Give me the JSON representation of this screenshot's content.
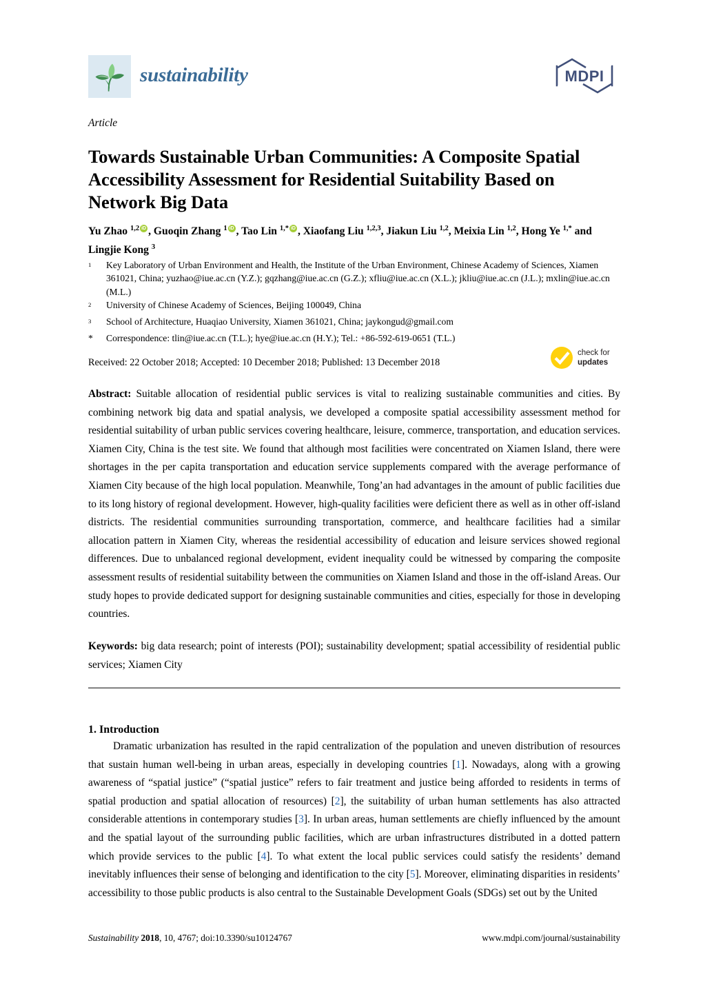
{
  "header": {
    "journal_name": "sustainability",
    "publisher_logo_text": "MDPI",
    "logo_icon": "seedling-leaf-icon"
  },
  "article_type": "Article",
  "title": "Towards Sustainable Urban Communities: A Composite Spatial Accessibility Assessment for Residential Suitability Based on Network Big Data",
  "authors_line_1_html": "Yu Zhao <sup>1,2</sup>ORCID, Guoqin Zhang <sup>1</sup>ORCID, Tao Lin <sup>1,*</sup>ORCID, Xiaofang Liu <sup>1,2,3</sup>, Jiakun Liu <sup>1,2</sup>, Meixia Lin <sup>1,2</sup>,",
  "authors_line_2_html": "Hong Ye <sup>1,*</sup> and Lingjie Kong <sup>3</sup>",
  "authors": [
    {
      "name": "Yu Zhao",
      "sup": "1,2",
      "orcid": true
    },
    {
      "name": "Guoqin Zhang",
      "sup": "1",
      "orcid": true
    },
    {
      "name": "Tao Lin",
      "sup": "1,*",
      "orcid": true
    },
    {
      "name": "Xiaofang Liu",
      "sup": "1,2,3",
      "orcid": false
    },
    {
      "name": "Jiakun Liu",
      "sup": "1,2",
      "orcid": false
    },
    {
      "name": "Meixia Lin",
      "sup": "1,2",
      "orcid": false
    },
    {
      "name": "Hong Ye",
      "sup": "1,*",
      "orcid": false
    },
    {
      "name": "Lingjie Kong",
      "sup": "3",
      "orcid": false
    }
  ],
  "affiliations": [
    {
      "marker": "1",
      "text": "Key Laboratory of Urban Environment and Health, the Institute of the Urban Environment, Chinese Academy of Sciences, Xiamen 361021, China; yuzhao@iue.ac.cn (Y.Z.); gqzhang@iue.ac.cn (G.Z.); xfliu@iue.ac.cn (X.L.); jkliu@iue.ac.cn (J.L.); mxlin@iue.ac.cn (M.L.)"
    },
    {
      "marker": "2",
      "text": "University of Chinese Academy of Sciences, Beijing 100049, China"
    },
    {
      "marker": "3",
      "text": "School of Architecture, Huaqiao University, Xiamen 361021, China; jaykongud@gmail.com"
    },
    {
      "marker": "*",
      "text": "Correspondence: tlin@iue.ac.cn (T.L.); hye@iue.ac.cn (H.Y.); Tel.: +86-592-619-0651 (T.L.)"
    }
  ],
  "dates_line": "Received: 22 October 2018; Accepted: 10 December 2018; Published: 13 December 2018",
  "check_for_updates": {
    "line1": "check for",
    "line2": "updates",
    "icon": "yellow-check-circle-icon",
    "color": "#ffd10d"
  },
  "abstract": {
    "label": "Abstract:",
    "text": " Suitable allocation of residential public services is vital to realizing sustainable communities and cities.  By combining network big data and spatial analysis, we developed a composite spatial accessibility assessment method for residential suitability of urban public services covering healthcare, leisure, commerce, transportation, and education services.  Xiamen City, China is the test site.  We found that although most facilities were concentrated on Xiamen Island, there were shortages in the per capita transportation and education service supplements compared with the average performance of Xiamen City because of the high local population. Meanwhile, Tong’an had advantages in the amount of public facilities due to its long history of regional development. However, high-quality facilities were deficient there as well as in other off-island districts.  The residential communities surrounding transportation, commerce, and healthcare facilities had a similar allocation pattern in Xiamen City, whereas the residential accessibility of education and leisure services showed regional differences. Due to unbalanced regional development, evident inequality could be witnessed by comparing the composite assessment results of residential suitability between the communities on Xiamen Island and those in the off-island Areas. Our study hopes to provide dedicated support for designing sustainable communities and cities, especially for those in developing countries."
  },
  "keywords": {
    "label": "Keywords:",
    "text": " big data research; point of interests (POI); sustainability development; spatial accessibility of residential public services; Xiamen City"
  },
  "section": {
    "heading": "1. Introduction",
    "paragraph_parts": [
      "Dramatic urbanization has resulted in the rapid centralization of the population and uneven distribution of resources that sustain human well-being in urban areas, especially in developing countries [",
      "1",
      "]. Nowadays, along with a growing awareness of “spatial justice” (“spatial justice” refers to fair treatment and justice being afforded to residents in terms of spatial production and spatial allocation of resources) [",
      "2",
      "], the suitability of urban human settlements has also attracted considerable attentions in contemporary studies [",
      "3",
      "]. In urban areas, human settlements are chiefly influenced by the amount and the spatial layout of the surrounding public facilities, which are urban infrastructures distributed in a dotted pattern which provide services to the public [",
      "4",
      "].  To what extent the local public services could satisfy the residents’ demand inevitably influences their sense of belonging and identification to the city [",
      "5",
      "]. Moreover, eliminating disparities in residents’ accessibility to those public products is also central to the Sustainable Development Goals (SDGs) set out by the United"
    ],
    "reference_links": [
      "1",
      "2",
      "3",
      "4",
      "5"
    ]
  },
  "footer": {
    "journal_italic": "Sustainability",
    "year": "2018",
    "volume": ", 10, 4767; doi:10.3390/su10124767",
    "citation_full": "Sustainability 2018, 10, 4767; doi:10.3390/su10124767",
    "url": "www.mdpi.com/journal/sustainability"
  },
  "colors": {
    "journal_blue": "#3a6b96",
    "logo_bg": "#dce9f2",
    "leaf_green": "#4a9c5d",
    "mdpi_navy": "#41507a",
    "orcid_green": "#a6ce39",
    "check_yellow": "#ffd10d",
    "reference_blue": "#2a6ebb",
    "rule_gray": "#808080"
  }
}
